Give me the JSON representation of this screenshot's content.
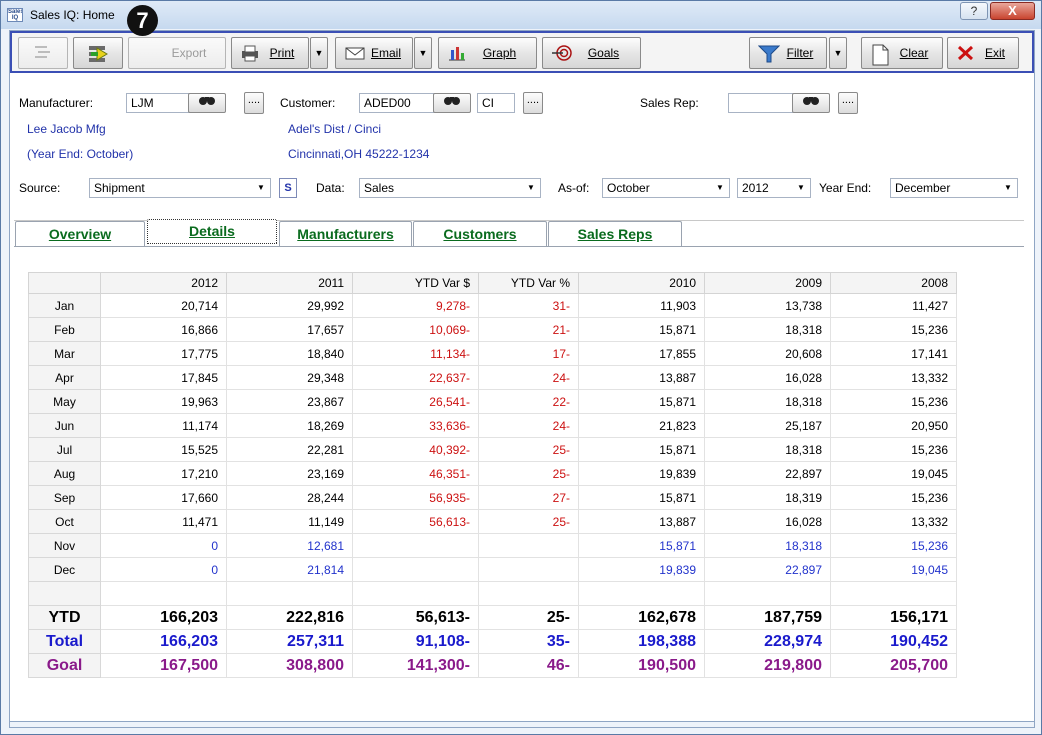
{
  "window": {
    "title": "Sales IQ: Home",
    "app_icon_text": "Sales IQ",
    "step_badge": "7",
    "help_label": "?",
    "close_label": "X"
  },
  "toolbar": {
    "export_label": "Export",
    "print_label": "Print",
    "email_label": "Email",
    "graph_label": "Graph",
    "goals_label": "Goals",
    "filter_label": "Filter",
    "clear_label": "Clear",
    "exit_label": "Exit"
  },
  "form": {
    "manufacturer_label": "Manufacturer:",
    "manufacturer_value": "LJM",
    "manufacturer_name": "Lee Jacob Mfg",
    "manufacturer_yearend": "(Year End: October)",
    "customer_label": "Customer:",
    "customer_value": "ADED00",
    "customer_suffix": "CI",
    "customer_name": "Adel's Dist / Cinci",
    "customer_address": "Cincinnati,OH 45222-1234",
    "salesrep_label": "Sales Rep:",
    "salesrep_value": "",
    "ellipsis": "....",
    "source_label": "Source:",
    "source_value": "Shipment",
    "s_button": "S",
    "data_label": "Data:",
    "data_value": "Sales",
    "asof_label": "As-of:",
    "asof_month": "October",
    "asof_year": "2012",
    "yearend_label": "Year End:",
    "yearend_value": "December"
  },
  "tabs": [
    {
      "label": "Overview"
    },
    {
      "label": "Details"
    },
    {
      "label": "Manufacturers"
    },
    {
      "label": "Customers"
    },
    {
      "label": "Sales Reps"
    }
  ],
  "grid": {
    "columns": [
      "2012",
      "2011",
      "YTD Var $",
      "YTD Var %",
      "2010",
      "2009",
      "2008"
    ],
    "rows": [
      {
        "label": "Jan",
        "cells": [
          "20,714",
          "29,992",
          "9,278-",
          "31-",
          "11,903",
          "13,738",
          "11,427"
        ]
      },
      {
        "label": "Feb",
        "cells": [
          "16,866",
          "17,657",
          "10,069-",
          "21-",
          "15,871",
          "18,318",
          "15,236"
        ]
      },
      {
        "label": "Mar",
        "cells": [
          "17,775",
          "18,840",
          "11,134-",
          "17-",
          "17,855",
          "20,608",
          "17,141"
        ]
      },
      {
        "label": "Apr",
        "cells": [
          "17,845",
          "29,348",
          "22,637-",
          "24-",
          "13,887",
          "16,028",
          "13,332"
        ]
      },
      {
        "label": "May",
        "cells": [
          "19,963",
          "23,867",
          "26,541-",
          "22-",
          "15,871",
          "18,318",
          "15,236"
        ]
      },
      {
        "label": "Jun",
        "cells": [
          "11,174",
          "18,269",
          "33,636-",
          "24-",
          "21,823",
          "25,187",
          "20,950"
        ]
      },
      {
        "label": "Jul",
        "cells": [
          "15,525",
          "22,281",
          "40,392-",
          "25-",
          "15,871",
          "18,318",
          "15,236"
        ]
      },
      {
        "label": "Aug",
        "cells": [
          "17,210",
          "23,169",
          "46,351-",
          "25-",
          "19,839",
          "22,897",
          "19,045"
        ]
      },
      {
        "label": "Sep",
        "cells": [
          "17,660",
          "28,244",
          "56,935-",
          "27-",
          "15,871",
          "18,319",
          "15,236"
        ]
      },
      {
        "label": "Oct",
        "cells": [
          "11,471",
          "11,149",
          "56,613-",
          "25-",
          "13,887",
          "16,028",
          "13,332"
        ]
      },
      {
        "label": "Nov",
        "cells": [
          "0",
          "12,681",
          "",
          "",
          "15,871",
          "18,318",
          "15,236"
        ]
      },
      {
        "label": "Dec",
        "cells": [
          "0",
          "21,814",
          "",
          "",
          "19,839",
          "22,897",
          "19,045"
        ]
      }
    ],
    "ytd": {
      "label": "YTD",
      "cells": [
        "166,203",
        "222,816",
        "56,613-",
        "25-",
        "162,678",
        "187,759",
        "156,171"
      ]
    },
    "total": {
      "label": "Total",
      "cells": [
        "166,203",
        "257,311",
        "91,108-",
        "35-",
        "198,388",
        "228,974",
        "190,452"
      ]
    },
    "goal": {
      "label": "Goal",
      "cells": [
        "167,500",
        "308,800",
        "141,300-",
        "46-",
        "190,500",
        "219,800",
        "205,700"
      ]
    }
  }
}
